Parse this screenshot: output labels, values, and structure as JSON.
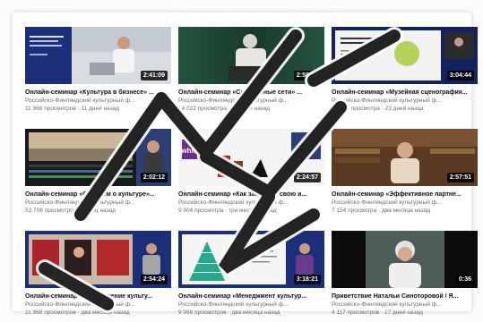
{
  "videos": [
    {
      "title": "Онлайн-семинар «Культура в бизнесе» ...",
      "channel": "Российско-Финляндский культурный ф...",
      "meta": "11 968 просмотров · 11 дней назад",
      "duration": "2:41:09",
      "slide_text": "Культура в бизнесе"
    },
    {
      "title": "Онлайн-семинар «Социальные сети» ...",
      "channel": "Российско-Финляндский культурный ф...",
      "meta": "14 022 просмотра · 11 дней назад",
      "duration": "2:58:36"
    },
    {
      "title": "Онлайн-семинар «Музейная сценография...",
      "channel": "Российско-Финляндский культурный ф...",
      "meta": "37 494 просмотра · 23 дней назад",
      "duration": "3:04:44",
      "slide_text": "От выставки к инсталляции"
    },
    {
      "title": "Онлайн-семинар «Снимаем о культуре»...",
      "channel": "Российско-Финляндский культурный ф...",
      "meta": "53 708 просмотров · месяц назад",
      "duration": "2:02:12"
    },
    {
      "title": "Онлайн-семинар «Как защитить свою и...",
      "channel": "Российско-Финляндский культурный ф...",
      "meta": "9 904 просмотра · три месяца назад",
      "duration": "2:24:57",
      "slide_text": "whiskas"
    },
    {
      "title": "Онлайн-семинар «Эффективное партне...",
      "channel": "Российско-Финляндский культурный ф...",
      "meta": "7 154 просмотра · два месяца назад",
      "duration": "2:57:51"
    },
    {
      "title": "Онлайн-семинар «Продвижение культу...",
      "channel": "Российско-Финляндский культурный ф...",
      "meta": "11 968 просмотров · два месяца назад",
      "duration": "2:54:24"
    },
    {
      "title": "Онлайн-семинар «Менеджмент культур...",
      "channel": "Российско-Финляндский культурный ф...",
      "meta": "9 998 просмотров · два месяца назад",
      "duration": "3:18:21"
    },
    {
      "title": "Приветствие Натальи Синоторовой / Я...",
      "channel": "Российско-Финляндский культурный ф...",
      "meta": "4 117 просмотров · 17 дней назад",
      "duration": "0:36"
    }
  ],
  "colors": {
    "accent_blue": "#1e3a8a",
    "overlay_text": "#ffffff",
    "title_text": "#111111",
    "meta_text": "#6e6e6e"
  }
}
